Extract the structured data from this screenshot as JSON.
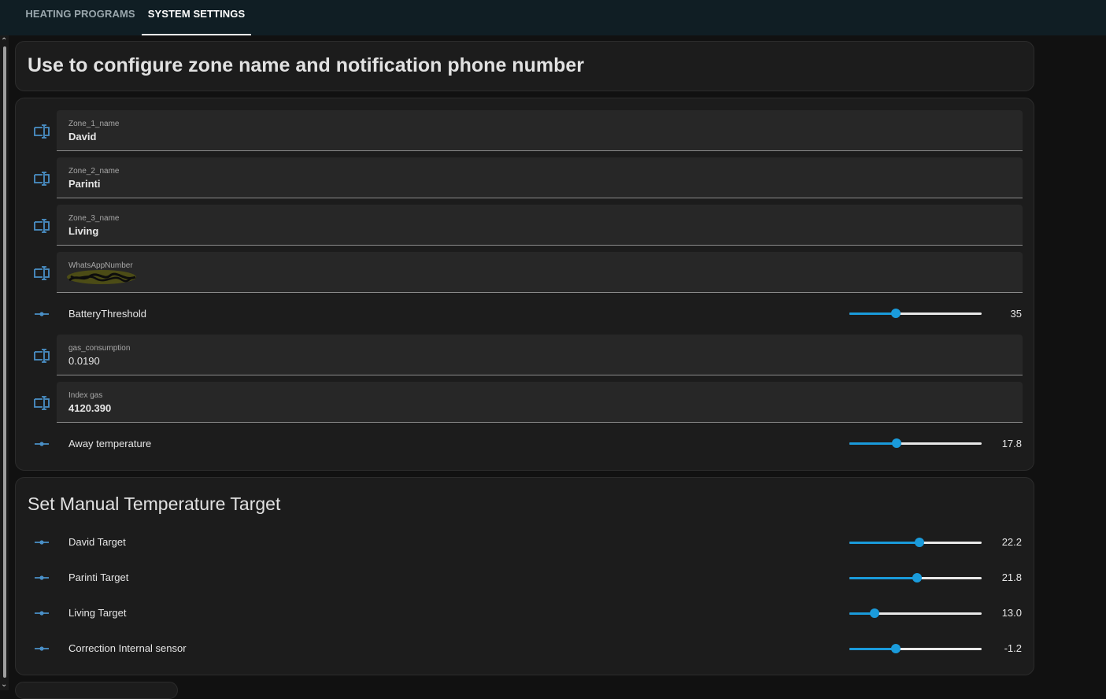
{
  "tabs": [
    {
      "label": "HEATING PROGRAMS"
    },
    {
      "label": "SYSTEM SETTINGS"
    }
  ],
  "config_card": {
    "title": "Use to configure zone name and notification phone number"
  },
  "settings": {
    "zone1": {
      "label": "Zone_1_name",
      "value": "David"
    },
    "zone2": {
      "label": "Zone_2_name",
      "value": "Parinti"
    },
    "zone3": {
      "label": "Zone_3_name",
      "value": "Living"
    },
    "whatsapp": {
      "label": "WhatsAppNumber"
    },
    "battery": {
      "label": "BatteryThreshold",
      "value": "35",
      "fraction": 0.35
    },
    "gas_consumption": {
      "label": "gas_consumption",
      "value": "0.0190"
    },
    "index_gas": {
      "label": "Index gas",
      "value": "4120.390"
    },
    "away": {
      "label": "Away temperature",
      "value": "17.8",
      "fraction": 0.36
    }
  },
  "manual_card": {
    "title": "Set Manual Temperature Target",
    "rows": [
      {
        "label": "David Target",
        "value": "22.2",
        "fraction": 0.53
      },
      {
        "label": "Parinti Target",
        "value": "21.8",
        "fraction": 0.51
      },
      {
        "label": "Living Target",
        "value": "13.0",
        "fraction": 0.19
      },
      {
        "label": "Correction Internal sensor",
        "value": "-1.2",
        "fraction": 0.35
      }
    ]
  },
  "colors": {
    "accent": "#1a9bdb",
    "icon": "#4a90c8",
    "background": "#111111",
    "card": "#1c1c1c",
    "tabbar": "#101e24"
  },
  "icons": {
    "text_entity": "form-textbox-icon",
    "number_entity": "ray-vertex-icon"
  }
}
